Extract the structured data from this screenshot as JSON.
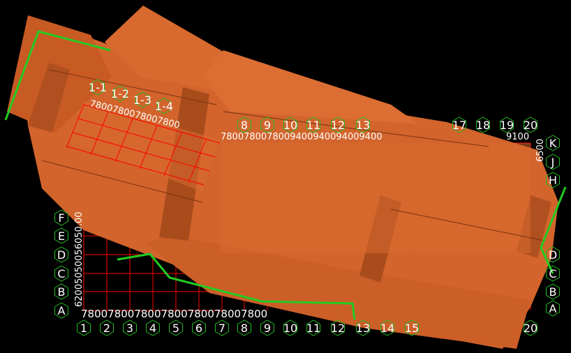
{
  "viewport": {
    "background": "#000000",
    "grid_color": "#ff0000",
    "axis_marker_color": "#22bb22",
    "axis_text_color": "#ffffff",
    "building_color": "#d2642c",
    "building_shadow_color": "#a24818",
    "path_color": "#22cc22"
  },
  "axes": {
    "bottom_numbers": [
      "1",
      "2",
      "3",
      "4",
      "5",
      "6",
      "7",
      "8",
      "9",
      "10",
      "11",
      "12",
      "13",
      "14",
      "15"
    ],
    "bottom_numbers_right": [
      "20"
    ],
    "top_numbers": [
      "8",
      "9",
      "10",
      "11",
      "12",
      "13",
      "17",
      "18",
      "19",
      "20"
    ],
    "left_letters": [
      "F",
      "E",
      "D",
      "C",
      "B",
      "A"
    ],
    "right_letters": [
      "K",
      "J",
      "H",
      "D",
      "C",
      "B",
      "A"
    ],
    "top_left_labels": [
      "1-1",
      "1-2",
      "1-3",
      "1-4"
    ]
  },
  "dimensions": {
    "bottom_row": "7800780078007800780078007800",
    "top_row_left": "7800780078007800",
    "top_row_mid": "7800780078009400940094009400",
    "top_row_right": "9100",
    "right_col_top": "6500",
    "left_col": "62005050056050.00"
  }
}
